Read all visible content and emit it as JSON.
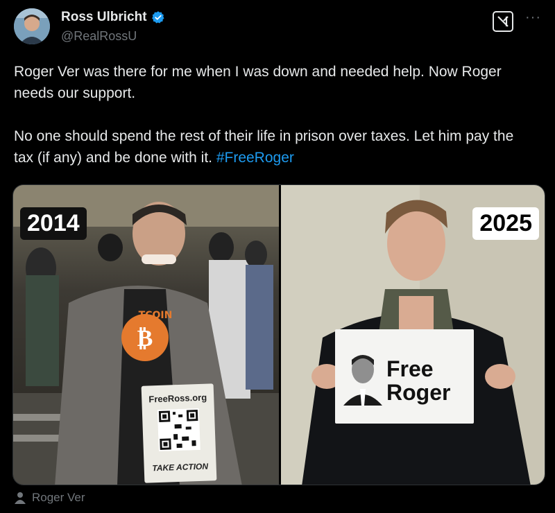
{
  "tweet": {
    "author": {
      "display_name": "Ross Ulbricht",
      "handle": "@RealRossU",
      "verified": true,
      "verified_color": "#1d9bf0"
    },
    "header_actions": {
      "grok_icon": "grok-icon",
      "more_icon": "more-icon",
      "more_label": "···"
    },
    "text": {
      "paragraph1": "Roger Ver was there for me when I was down and needed help. Now Roger needs our support.",
      "paragraph2_main": "No one should spend the rest of their life in prison over taxes. Let him pay the tax (if any) and be done with it. ",
      "hashtag": "#FreeRoger"
    },
    "media": {
      "left": {
        "year": "2014",
        "sign_site": "FreeRoss.org",
        "sign_action": "TAKE ACTION",
        "shirt_text": "TCOIN"
      },
      "right": {
        "year": "2025",
        "sign_text": "Free\nRoger"
      },
      "tagged_user": "Roger Ver",
      "tag_icon": "person-icon"
    }
  },
  "colors": {
    "background": "#000000",
    "text": "#e7e9ea",
    "secondary": "#71767b",
    "link": "#1d9bf0"
  }
}
